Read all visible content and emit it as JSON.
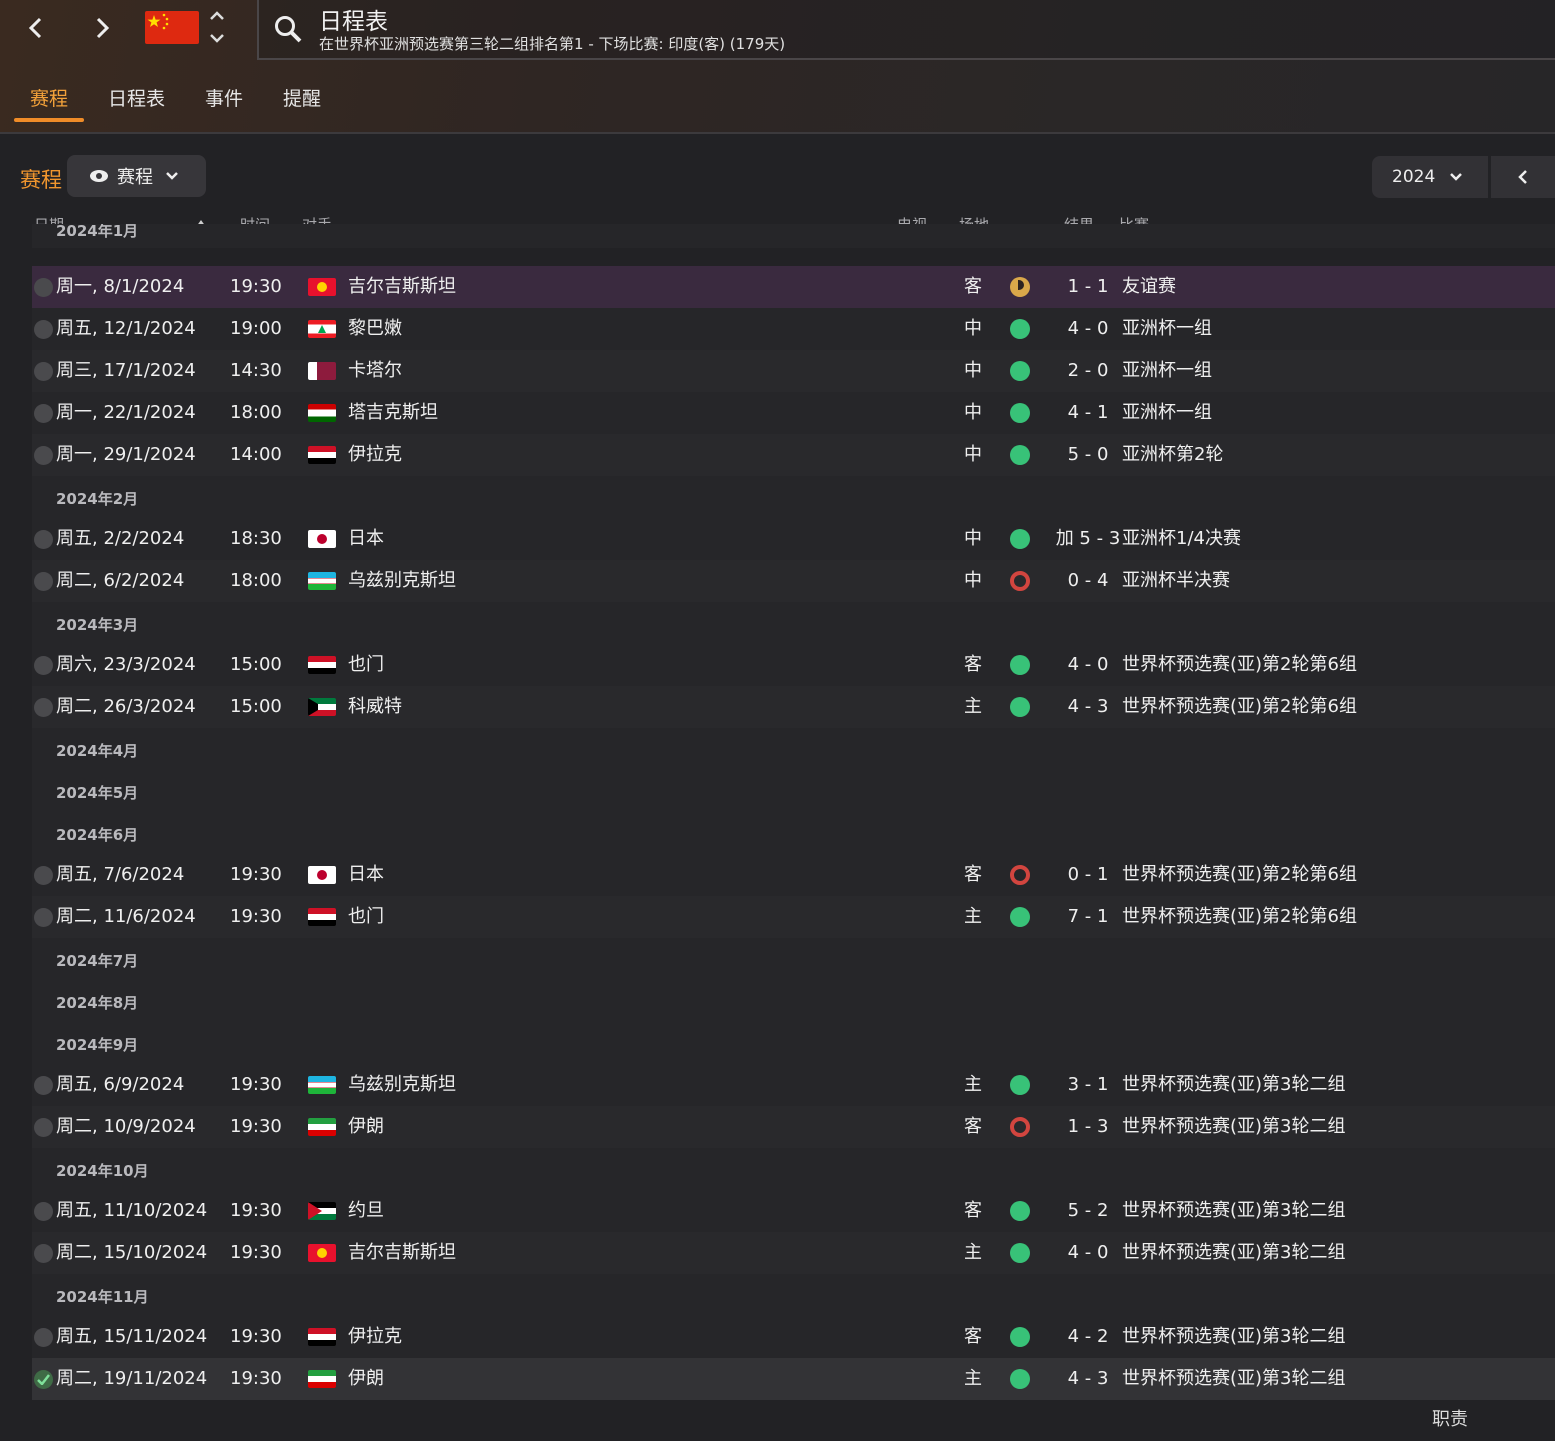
{
  "header": {
    "title": "日程表",
    "subtitle": "在世界杯亚洲预选赛第三轮二组排名第1 - 下场比赛: 印度(客) (179天)"
  },
  "tabs": [
    "赛程",
    "日程表",
    "事件",
    "提醒"
  ],
  "section": {
    "title": "赛程",
    "view_label": "赛程",
    "year": "2024"
  },
  "columns": {
    "date": "日期",
    "time": "时间",
    "opponent": "对手",
    "tv": "电视...",
    "venue": "场地",
    "result": "结果",
    "competition": "比赛"
  },
  "month_partial": "2024年1月",
  "rows": [
    {
      "type": "match",
      "date": "周一, 8/1/2024",
      "time": "19:30",
      "flag": "kgz",
      "opponent": "吉尔吉斯斯坦",
      "venue": "客",
      "outcome": "draw",
      "result": "1 - 1",
      "competition": "友谊赛"
    },
    {
      "type": "match",
      "date": "周五, 12/1/2024",
      "time": "19:00",
      "flag": "lbn",
      "opponent": "黎巴嫩",
      "venue": "中",
      "outcome": "win",
      "result": "4 - 0",
      "competition": "亚洲杯一组"
    },
    {
      "type": "match",
      "date": "周三, 17/1/2024",
      "time": "14:30",
      "flag": "qat",
      "opponent": "卡塔尔",
      "venue": "中",
      "outcome": "win",
      "result": "2 - 0",
      "competition": "亚洲杯一组"
    },
    {
      "type": "match",
      "date": "周一, 22/1/2024",
      "time": "18:00",
      "flag": "tjk",
      "opponent": "塔吉克斯坦",
      "venue": "中",
      "outcome": "win",
      "result": "4 - 1",
      "competition": "亚洲杯一组"
    },
    {
      "type": "match",
      "date": "周一, 29/1/2024",
      "time": "14:00",
      "flag": "irq",
      "opponent": "伊拉克",
      "venue": "中",
      "outcome": "win",
      "result": "5 - 0",
      "competition": "亚洲杯第2轮"
    },
    {
      "type": "month",
      "label": "2024年2月"
    },
    {
      "type": "match",
      "date": "周五, 2/2/2024",
      "time": "18:30",
      "flag": "jpn",
      "opponent": "日本",
      "venue": "中",
      "outcome": "win",
      "result": "加 5 - 3",
      "competition": "亚洲杯1/4决赛"
    },
    {
      "type": "match",
      "date": "周二, 6/2/2024",
      "time": "18:00",
      "flag": "uzb",
      "opponent": "乌兹别克斯坦",
      "venue": "中",
      "outcome": "loss",
      "result": "0 - 4",
      "competition": "亚洲杯半决赛"
    },
    {
      "type": "month",
      "label": "2024年3月"
    },
    {
      "type": "match",
      "date": "周六, 23/3/2024",
      "time": "15:00",
      "flag": "yem",
      "opponent": "也门",
      "venue": "客",
      "outcome": "win",
      "result": "4 - 0",
      "competition": "世界杯预选赛(亚)第2轮第6组"
    },
    {
      "type": "match",
      "date": "周二, 26/3/2024",
      "time": "15:00",
      "flag": "kwt",
      "opponent": "科威特",
      "venue": "主",
      "outcome": "win",
      "result": "4 - 3",
      "competition": "世界杯预选赛(亚)第2轮第6组"
    },
    {
      "type": "month",
      "label": "2024年4月"
    },
    {
      "type": "month",
      "label": "2024年5月"
    },
    {
      "type": "month",
      "label": "2024年6月"
    },
    {
      "type": "match",
      "date": "周五, 7/6/2024",
      "time": "19:30",
      "flag": "jpn",
      "opponent": "日本",
      "venue": "客",
      "outcome": "loss",
      "result": "0 - 1",
      "competition": "世界杯预选赛(亚)第2轮第6组"
    },
    {
      "type": "match",
      "date": "周二, 11/6/2024",
      "time": "19:30",
      "flag": "yem",
      "opponent": "也门",
      "venue": "主",
      "outcome": "win",
      "result": "7 - 1",
      "competition": "世界杯预选赛(亚)第2轮第6组"
    },
    {
      "type": "month",
      "label": "2024年7月"
    },
    {
      "type": "month",
      "label": "2024年8月"
    },
    {
      "type": "month",
      "label": "2024年9月"
    },
    {
      "type": "match",
      "date": "周五, 6/9/2024",
      "time": "19:30",
      "flag": "uzb",
      "opponent": "乌兹别克斯坦",
      "venue": "主",
      "outcome": "win",
      "result": "3 - 1",
      "competition": "世界杯预选赛(亚)第3轮二组"
    },
    {
      "type": "match",
      "date": "周二, 10/9/2024",
      "time": "19:30",
      "flag": "irn",
      "opponent": "伊朗",
      "venue": "客",
      "outcome": "loss",
      "result": "1 - 3",
      "competition": "世界杯预选赛(亚)第3轮二组"
    },
    {
      "type": "month",
      "label": "2024年10月"
    },
    {
      "type": "match",
      "date": "周五, 11/10/2024",
      "time": "19:30",
      "flag": "jor",
      "opponent": "约旦",
      "venue": "客",
      "outcome": "win",
      "result": "5 - 2",
      "competition": "世界杯预选赛(亚)第3轮二组"
    },
    {
      "type": "match",
      "date": "周二, 15/10/2024",
      "time": "19:30",
      "flag": "kgz",
      "opponent": "吉尔吉斯斯坦",
      "venue": "主",
      "outcome": "win",
      "result": "4 - 0",
      "competition": "世界杯预选赛(亚)第3轮二组"
    },
    {
      "type": "month",
      "label": "2024年11月"
    },
    {
      "type": "match",
      "date": "周五, 15/11/2024",
      "time": "19:30",
      "flag": "irq",
      "opponent": "伊拉克",
      "venue": "客",
      "outcome": "win",
      "result": "4 - 2",
      "competition": "世界杯预选赛(亚)第3轮二组"
    },
    {
      "type": "match",
      "date": "周二, 19/11/2024",
      "time": "19:30",
      "flag": "irn",
      "opponent": "伊朗",
      "venue": "主",
      "outcome": "win",
      "result": "4 - 3",
      "competition": "世界杯预选赛(亚)第3轮二组",
      "checked": true
    }
  ],
  "watermark": "职责"
}
